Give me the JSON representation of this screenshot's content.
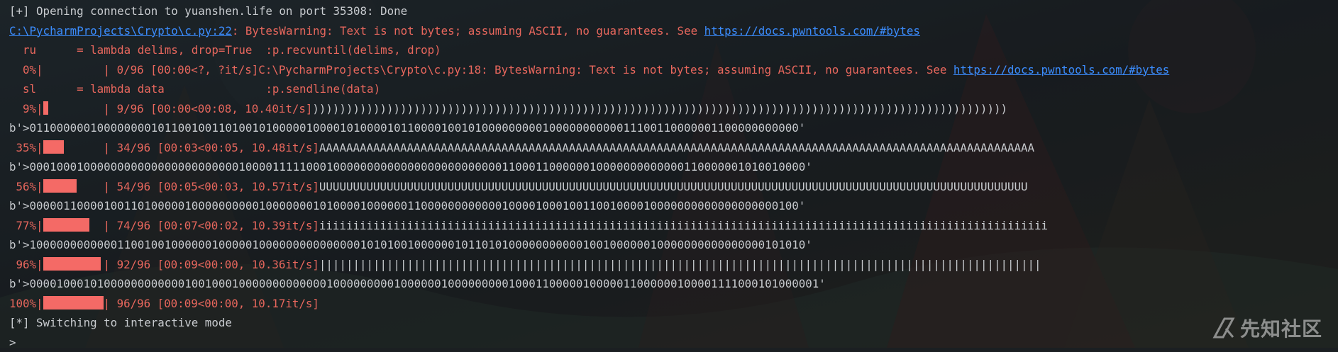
{
  "colors": {
    "background": "#1b1f22",
    "text": "#c8cbcf",
    "stderr": "#e8675d",
    "link": "#3b8dff",
    "progress_fill": "#f46a66"
  },
  "terminal": {
    "line1": "[+] Opening connection to yuanshen.life on port 35308: Done",
    "warn1_path": "C:\\PycharmProjects\\Crypto\\c.py:22",
    "warn1_text": ": BytesWarning: Text is not bytes; assuming ASCII, no guarantees. See ",
    "warn1_link": "https://docs.pwntools.com/#bytes",
    "ru_line": "  ru      = lambda delims, drop=True  :p.recvuntil(delims, drop)",
    "p0_prefix": "  0%|",
    "p0_bar": 0,
    "p0_suffix": "| 0/96 [00:00<?, ?it/s]C:\\PycharmProjects\\Crypto\\c.py:18: BytesWarning: Text is not bytes; assuming ASCII, no guarantees. See ",
    "p0_link": "https://docs.pwntools.com/#bytes",
    "sl_line": "  sl      = lambda data               :p.sendline(data)",
    "p1_prefix": "  9%|",
    "p1_bar": 0.09,
    "p1_suffix": "| 9/96 [00:00<00:08, 10.40it/s]",
    "p1_out": ")))))))))))))))))))))))))))))))))))))))))))))))))))))))))))))))))))))))))))))))))))))))))))))))))))))))",
    "b1": "b'>011000000100000000101100100110100101000001000010100001011000010010100000000010000000000011100110000001100000000000'",
    "p2_prefix": " 35%|",
    "p2_bar": 0.35,
    "p2_suffix": "| 34/96 [00:03<00:05, 10.48it/s]",
    "p2_out": "AAAAAAAAAAAAAAAAAAAAAAAAAAAAAAAAAAAAAAAAAAAAAAAAAAAAAAAAAAAAAAAAAAAAAAAAAAAAAAAAAAAAAAAAAAAAAAAAAAAAAAAAAA",
    "b2": "b'>0001000100000000000000000000000100001111100010000000000000000000000000110001100000010000000000000110000001010010000'",
    "p3_prefix": " 56%|",
    "p3_bar": 0.56,
    "p3_suffix": "| 54/96 [00:05<00:03, 10.57it/s]",
    "p3_out": "UUUUUUUUUUUUUUUUUUUUUUUUUUUUUUUUUUUUUUUUUUUUUUUUUUUUUUUUUUUUUUUUUUUUUUUUUUUUUUUUUUUUUUUUUUUUUUUUUUUUUUUUU",
    "b3": "b'>000001100001001101000001000000000010000000101000010000001100000000000010000100010011001000010000000000000000000100'",
    "p4_prefix": " 77%|",
    "p4_bar": 0.77,
    "p4_suffix": "| 74/96 [00:07<00:02, 10.39it/s]",
    "p4_out": "iiiiiiiiiiiiiiiiiiiiiiiiiiiiiiiiiiiiiiiiiiiiiiiiiiiiiiiiiiiiiiiiiiiiiiiiiiiiiiiiiiiiiiiiiiiiiiiiiiiiiiiiiiii",
    "b4": "b'>1000000000000110010010000001000001000000000000000101010010000001011010100000000000100100000010000000000000000101010'",
    "p5_prefix": " 96%|",
    "p5_bar": 0.96,
    "p5_suffix": "| 92/96 [00:09<00:00, 10.36it/s]",
    "p5_out": "|||||||||||||||||||||||||||||||||||||||||||||||||||||||||||||||||||||||||||||||||||||||||||||||||||||||||||",
    "b5": "b'>000010001010000000000001001000100000000000001000000000100000010000000001000110000010000011000000100001111000101000001'",
    "p6_prefix": "100%|",
    "p6_bar": 1,
    "p6_suffix": "| 96/96 [00:09<00:00, 10.17it/s]",
    "interactive": "[*] Switching to interactive mode",
    "prompt": ">"
  },
  "watermark": {
    "text": "先知社区"
  }
}
